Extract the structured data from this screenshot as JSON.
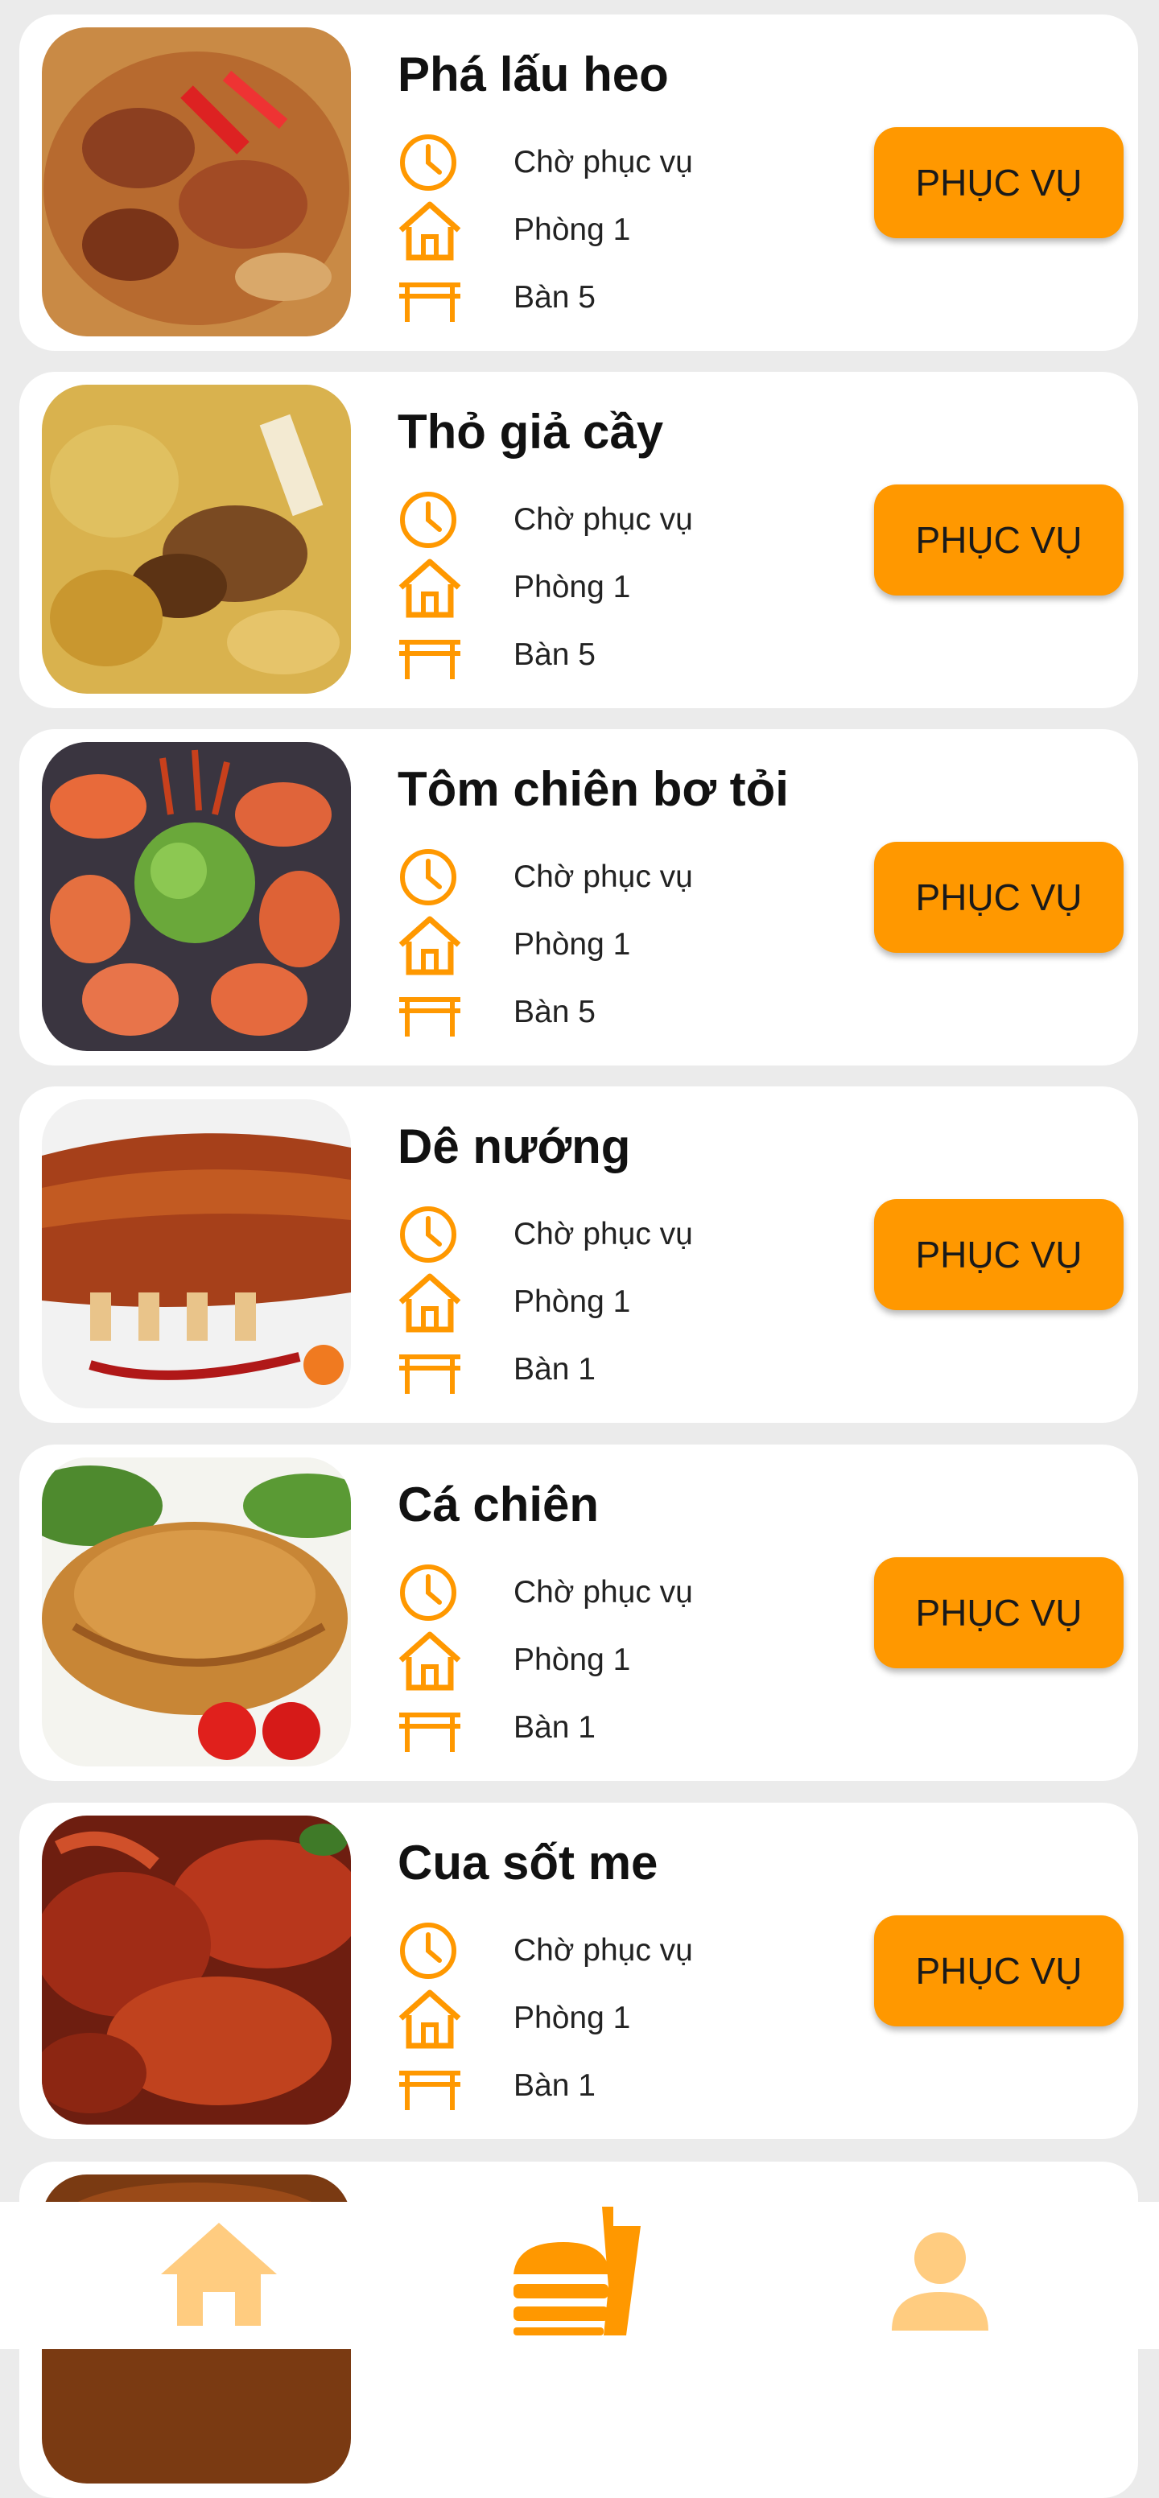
{
  "colors": {
    "accent": "#ff9800",
    "card": "#ffffff",
    "background": "#ebebeb",
    "nav_inactive": "#ffcc80"
  },
  "dishes": [
    {
      "name": "Phá lấu heo",
      "status": "Chờ phục vụ",
      "room": "Phòng 1",
      "table": "Bàn 5",
      "button": "PHỤC VỤ",
      "image": "pha-lau-photo"
    },
    {
      "name": "Thỏ giả cầy",
      "status": "Chờ phục vụ",
      "room": "Phòng 1",
      "table": "Bàn 5",
      "button": "PHỤC VỤ",
      "image": "tho-gia-cay-photo"
    },
    {
      "name": "Tôm chiên bơ tỏi",
      "status": "Chờ phục vụ",
      "room": "Phòng 1",
      "table": "Bàn 5",
      "button": "PHỤC VỤ",
      "image": "tom-chien-photo"
    },
    {
      "name": "Dê nướng",
      "status": "Chờ phục vụ",
      "room": "Phòng 1",
      "table": "Bàn 1",
      "button": "PHỤC VỤ",
      "image": "de-nuong-photo"
    },
    {
      "name": "Cá chiên",
      "status": "Chờ phục vụ",
      "room": "Phòng 1",
      "table": "Bàn 1",
      "button": "PHỤC VỤ",
      "image": "ca-chien-photo"
    },
    {
      "name": "Cua sốt me",
      "status": "Chờ phục vụ",
      "room": "Phòng 1",
      "table": "Bàn 1",
      "button": "PHỤC VỤ",
      "image": "cua-sot-me-photo"
    }
  ],
  "row_icons": {
    "status": "clock-icon",
    "room": "house-icon",
    "table": "table-icon"
  },
  "bottom_nav": [
    {
      "icon": "home-icon",
      "active": false
    },
    {
      "icon": "food-icon",
      "active": true
    },
    {
      "icon": "person-icon",
      "active": false
    }
  ]
}
